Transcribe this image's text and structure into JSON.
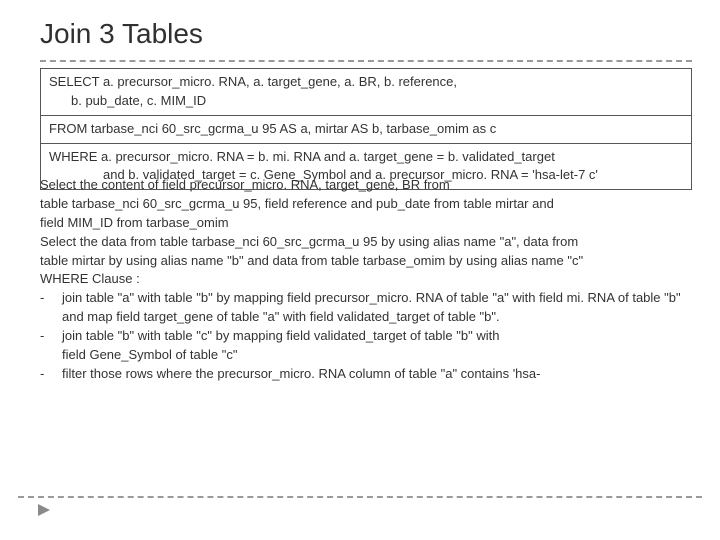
{
  "title": "Join 3 Tables",
  "sql": {
    "select": "SELECT a. precursor_micro. RNA, a. target_gene, a. BR, b. reference,",
    "select_cont": "b. pub_date, c. MIM_ID",
    "from": "FROM tarbase_nci 60_src_gcrma_u 95 AS a, mirtar AS b, tarbase_omim as c",
    "where": "WHERE a. precursor_micro. RNA = b. mi. RNA and a. target_gene = b. validated_target",
    "where_cont": "and b. validated_target = c. Gene_Symbol and a. precursor_micro. RNA = 'hsa-let-7 c'"
  },
  "explain": {
    "l1": "Select the content of field precursor_micro. RNA,  target_gene,  BR from",
    "l2": "table tarbase_nci 60_src_gcrma_u 95,  field reference and pub_date from table mirtar and",
    "l3": "field MIM_ID from tarbase_omim",
    "l4": "Select the data from table tarbase_nci 60_src_gcrma_u 95 by using alias name \"a\", data from",
    "l5": "table mirtar by using alias name \"b\" and data from table tarbase_omim by using alias name \"c\"",
    "l6": "WHERE Clause :",
    "b1": "join table \"a\" with table \"b\" by mapping field precursor_micro. RNA of table \"a\" with field  mi. RNA of table \"b\" and map field target_gene of table \"a\" with field validated_target of table \"b\".",
    "b2": "join table \"b\" with table \"c\" by mapping field validated_target of table \"b\" with",
    "b2b": "field Gene_Symbol of table \"c\"",
    "b3": "filter those rows where the precursor_micro. RNA column of table \"a\" contains 'hsa-"
  }
}
